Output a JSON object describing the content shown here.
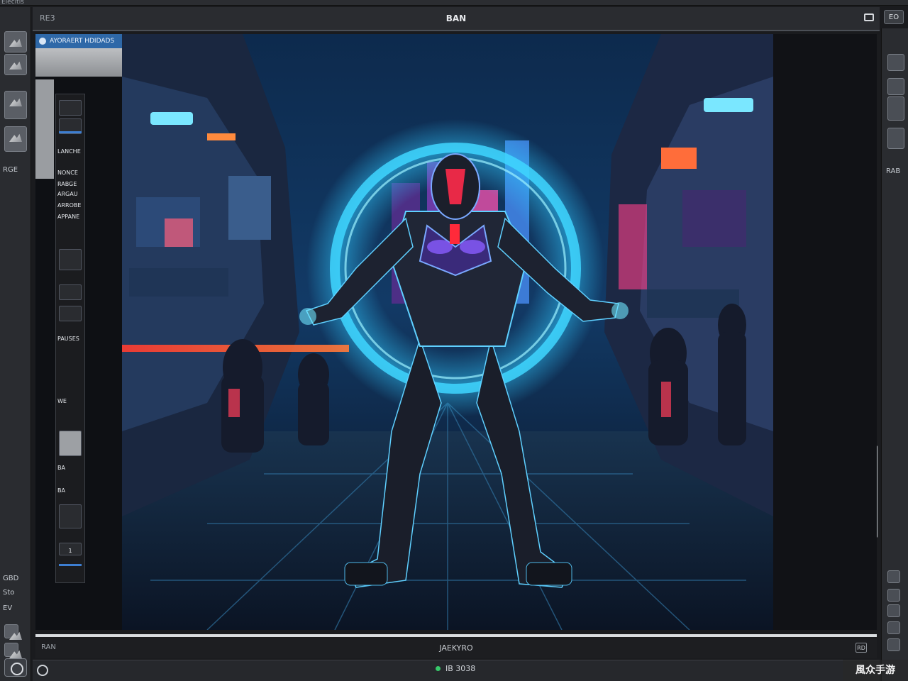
{
  "top_strip": {
    "label": "Elecitis"
  },
  "titlebar": {
    "left_label": "RE3",
    "title": "BAN",
    "right_badge": "EO"
  },
  "left_rail": {
    "labels": [
      "RGE",
      "GBD",
      "Sto",
      "EV"
    ]
  },
  "right_rail": {
    "labels": [
      "RAB"
    ]
  },
  "panel": {
    "header": "AYORAERT HDIDADS",
    "tools": [
      "LANCHE",
      "NONCE",
      "RABGE",
      "ARGAU",
      "ARROBE",
      "APPANE",
      "PAUSES",
      "WE",
      "BA",
      "BA",
      "1"
    ]
  },
  "status": {
    "left": "RAN",
    "center": "JAEKYRO",
    "right": "RD"
  },
  "taskbar": {
    "text": "IB 3038"
  },
  "watermark": "風众手游",
  "colors": {
    "accent": "#2e68a8",
    "status_dot": "#37c96a",
    "neon_blue": "#3fd6ff",
    "neon_red": "#ff2a3a"
  }
}
